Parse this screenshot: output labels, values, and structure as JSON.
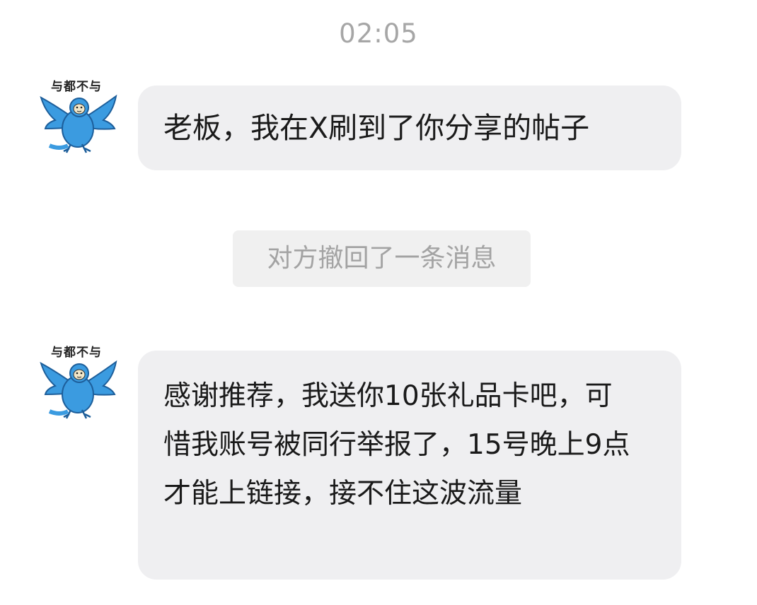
{
  "chat": {
    "timestamp": "02:05",
    "avatar_caption": "与都不与",
    "messages": [
      {
        "sender": "other",
        "text": "老板，我在X刷到了你分享的帖子"
      },
      {
        "sender": "other",
        "text": "感谢推荐，我送你10张礼品卡吧，可惜我账号被同行举报了，15号晚上9点才能上链接，接不住这波流量"
      }
    ],
    "system_notice": "对方撤回了一条消息"
  },
  "colors": {
    "bubble_bg": "#efeff1",
    "notice_bg": "#f0f0f0",
    "muted_text": "#a6a6a6",
    "bird_blue": "#3b9be0"
  },
  "icons": {
    "avatar": "blue-bird-meme-icon"
  }
}
